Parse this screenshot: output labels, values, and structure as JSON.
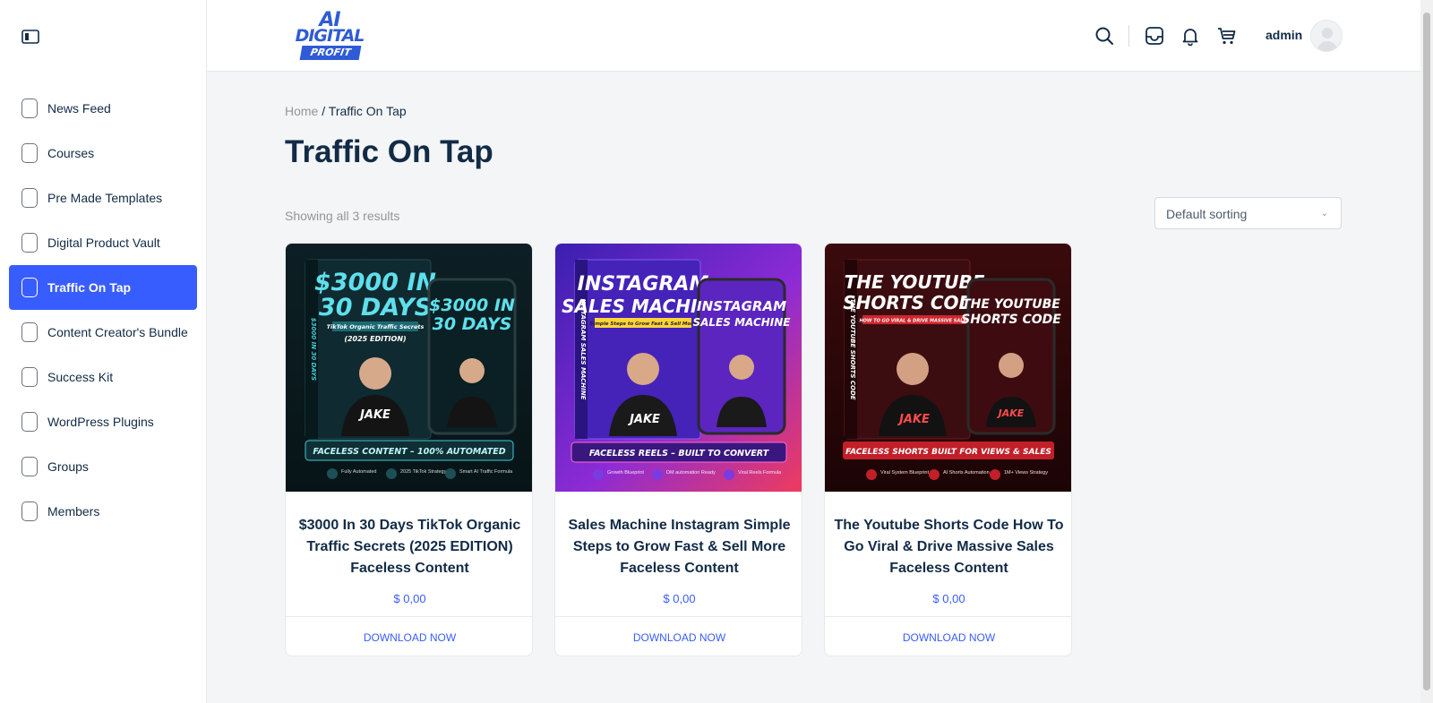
{
  "sidebar": {
    "items": [
      {
        "label": "News Feed"
      },
      {
        "label": "Courses"
      },
      {
        "label": "Pre Made Templates"
      },
      {
        "label": "Digital Product Vault"
      },
      {
        "label": "Traffic On Tap",
        "active": true
      },
      {
        "label": "Content Creator's Bundle"
      },
      {
        "label": "Success Kit"
      },
      {
        "label": "WordPress Plugins"
      },
      {
        "label": "Groups"
      },
      {
        "label": "Members"
      }
    ]
  },
  "header": {
    "logo": {
      "line1": "AI",
      "line2": "DIGITAL",
      "line3": "PROFIT"
    },
    "username": "admin",
    "icons": [
      "search-icon",
      "inbox-icon",
      "bell-icon",
      "cart-icon"
    ]
  },
  "breadcrumb": {
    "home": "Home",
    "separator": " / ",
    "current": "Traffic On Tap"
  },
  "page_title": "Traffic On Tap",
  "result_count": "Showing all 3 results",
  "sorting": {
    "selected": "Default sorting"
  },
  "products": [
    {
      "title": "$3000 In 30 Days TikTok Organic Traffic Secrets (2025 EDITION) Faceless Content",
      "price": "$ 0,00",
      "button": "DOWNLOAD NOW",
      "cover": {
        "headline1": "$3000 IN",
        "headline2": "30 DAYS",
        "sub": "TikTok Organic Traffic Secrets",
        "edition": "(2025 EDITION)",
        "spine": "$3000 IN 30 DAYS",
        "name": "JAKE",
        "banner": "FACELESS CONTENT – 100% AUTOMATED",
        "features": [
          "Fully Automated",
          "2025 TikTok Strategy",
          "Smart AI Traffic Formula"
        ]
      }
    },
    {
      "title": "Sales Machine Instagram Simple Steps to Grow Fast & Sell More Faceless Content",
      "price": "$ 0,00",
      "button": "DOWNLOAD NOW",
      "cover": {
        "headline1": "INSTAGRAM",
        "headline2": "SALES MACHINE",
        "sub": "Simple Steps to Grow Fast & Sell More",
        "spine": "INSTAGRAM SALES MACHINE",
        "name": "JAKE",
        "banner": "FACELESS REELS – BUILT TO CONVERT",
        "features": [
          "Growth Blueprint",
          "DM automation Ready",
          "Viral Reels Formula"
        ]
      }
    },
    {
      "title": "The Youtube Shorts Code How To Go Viral & Drive Massive Sales Faceless Content",
      "price": "$ 0,00",
      "button": "DOWNLOAD NOW",
      "cover": {
        "headline1": "THE YOUTUBE",
        "headline2": "SHORTS CODE",
        "sub": "HOW TO GO VIRAL & DRIVE MASSIVE SALES",
        "spine": "THE YOUTUBE SHORTS CODE",
        "name": "JAKE",
        "banner": "FACELESS SHORTS BUILT FOR VIEWS & SALES",
        "features": [
          "Viral System Blueprint",
          "AI Shorts Automation",
          "1M+ Views Strategy"
        ]
      }
    }
  ],
  "colors": {
    "accent": "#385dff",
    "text": "#122b46",
    "muted": "#939597",
    "background": "#f4f5f7"
  }
}
